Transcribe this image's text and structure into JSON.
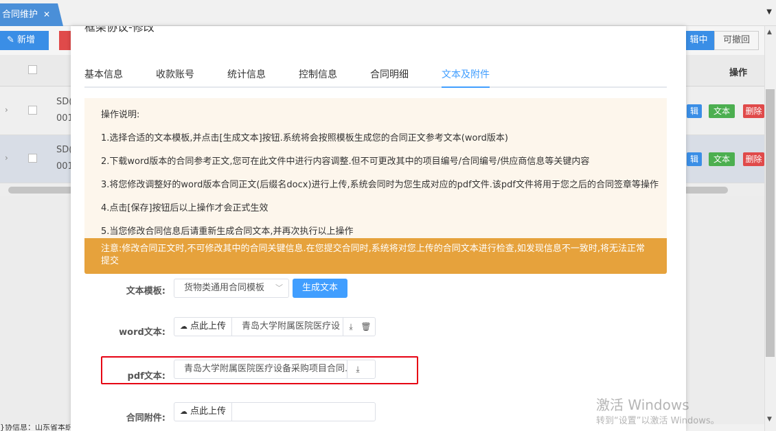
{
  "topbar": {
    "tab_label": "合同维护",
    "tab_close": "✕",
    "dropdown": "▼"
  },
  "background": {
    "add_button": "✎  新增",
    "segments": [
      "辑中",
      "可撤回"
    ],
    "op_header": "操作",
    "rows": [
      {
        "code_top": "SD(",
        "code_bottom": "001",
        "btn_edit": "辑",
        "btn_text": "文本",
        "btn_delete": "删除"
      },
      {
        "code_top": "SD(",
        "code_bottom": "001",
        "btn_edit": "辑",
        "btn_text": "文本",
        "btn_delete": "删除"
      }
    ],
    "footer_text": "}协信息：山东省本织@青岛大学附"
  },
  "modal": {
    "title": "框架协议-修改",
    "close": "✕",
    "tabs": [
      {
        "label": "基本信息",
        "active": false
      },
      {
        "label": "收款账号",
        "active": false
      },
      {
        "label": "统计信息",
        "active": false
      },
      {
        "label": "控制信息",
        "active": false
      },
      {
        "label": "合同明细",
        "active": false
      },
      {
        "label": "文本及附件",
        "active": true
      }
    ],
    "instructions": [
      "操作说明:",
      "1.选择合适的文本模板,并点击[生成文本]按钮.系统将会按照模板生成您的合同正文参考文本(word版本)",
      "2.下载word版本的合同参考正文,您可在此文件中进行内容调整.但不可更改其中的项目编号/合同编号/供应商信息等关键内容",
      "3.将您修改调整好的word版本合同正文(后缀名docx)进行上传,系统会同时为您生成对应的pdf文件.该pdf文件将用于您之后的合同签章等操作",
      "4.点击[保存]按钮后以上操作才会正式生效",
      "5.当您修改合同信息后请重新生成合同文本,并再次执行以上操作"
    ],
    "warning": "注意:修改合同正文时,不可修改其中的合同关键信息.在您提交合同时,系统将对您上传的合同文本进行检查,如发现信息不一致时,将无法正常提交",
    "form": {
      "template_label": "文本模板:",
      "template_value": "货物类通用合同模板",
      "generate_button": "生成文本",
      "word_label": "word文本:",
      "upload_label": "点此上传",
      "word_file": "青岛大学附属医院医疗设",
      "pdf_label": "pdf文本:",
      "pdf_file": "青岛大学附属医院医疗设备采购项目合同.",
      "attachment_label": "合同附件:"
    },
    "colors": {
      "accent": "#409eff",
      "warning": "#e6a23c",
      "highlight": "#e60012"
    }
  },
  "watermark": {
    "line1": "激活 Windows",
    "line2": "转到“设置”以激活 Windows。"
  }
}
